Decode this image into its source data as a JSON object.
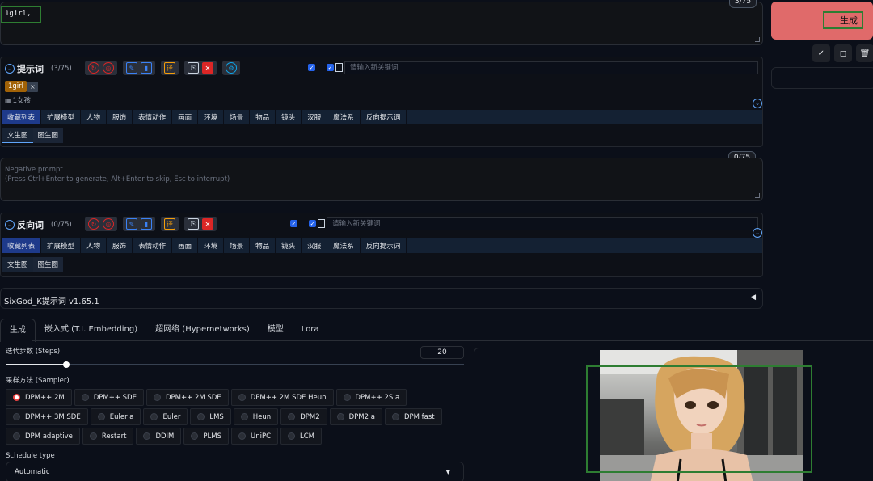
{
  "prompt": {
    "text": "1girl,",
    "counter": "3/75"
  },
  "generate": {
    "label": "生成",
    "icons": [
      "check-icon",
      "square-icon",
      "trash-icon"
    ]
  },
  "pos_section": {
    "title": "提示词",
    "count": "(3/75)",
    "keyword_placeholder": "请输入新关键词",
    "tag_label": "1girl",
    "tag_close": "×",
    "tag_translation": "1女孩",
    "tabs": [
      "收藏列表",
      "扩展模型",
      "人物",
      "服饰",
      "表情动作",
      "画面",
      "环境",
      "场景",
      "物品",
      "镜头",
      "汉服",
      "魔法系",
      "反向提示词"
    ],
    "subtabs": [
      "文生图",
      "图生图"
    ]
  },
  "negative": {
    "counter": "0/75",
    "placeholder_line1": "Negative prompt",
    "placeholder_line2": "(Press Ctrl+Enter to generate, Alt+Enter to skip, Esc to interrupt)"
  },
  "neg_section": {
    "title": "反向词",
    "count": "(0/75)",
    "keyword_placeholder": "请输入新关键词",
    "tabs": [
      "收藏列表",
      "扩展模型",
      "人物",
      "服饰",
      "表情动作",
      "画面",
      "环境",
      "场景",
      "物品",
      "镜头",
      "汉服",
      "魔法系",
      "反向提示词"
    ],
    "subtabs": [
      "文生图",
      "图生图"
    ]
  },
  "extension": {
    "title": "SixGod_K提示词 v1.65.1",
    "arrow": "◀"
  },
  "main_tabs": [
    "生成",
    "嵌入式 (T.I. Embedding)",
    "超网络 (Hypernetworks)",
    "模型",
    "Lora"
  ],
  "steps": {
    "label": "迭代步数 (Steps)",
    "value": "20",
    "slider_fraction": 0.133
  },
  "sampler": {
    "label": "采样方法 (Sampler)",
    "selected": "DPM++ 2M",
    "options": [
      "DPM++ 2M",
      "DPM++ SDE",
      "DPM++ 2M SDE",
      "DPM++ 2M SDE Heun",
      "DPM++ 2S a",
      "DPM++ 3M SDE",
      "Euler a",
      "Euler",
      "LMS",
      "Heun",
      "DPM2",
      "DPM2 a",
      "DPM fast",
      "DPM adaptive",
      "Restart",
      "DDIM",
      "PLMS",
      "UniPC",
      "LCM"
    ]
  },
  "schedule": {
    "label": "Schedule type",
    "value": "Automatic"
  },
  "colors": {
    "generate": "#e06a6a",
    "highlight": "#2e7d32",
    "accent": "#2563eb"
  }
}
